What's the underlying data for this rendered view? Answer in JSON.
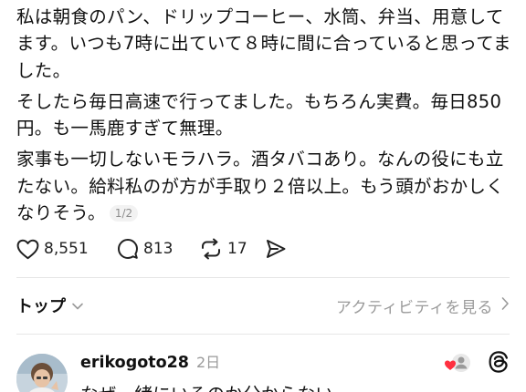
{
  "post": {
    "paragraphs": [
      "私は朝食のパン、ドリップコーヒー、水筒、弁当、用意してます。いつも7時に出ていて８時に間に合っていると思ってました。",
      "そしたら毎日高速で行ってました。もちろん実費。毎日850円。も一馬鹿すぎて無理。",
      "家事も一切しないモラハラ。酒タバコあり。なんの役にも立たない。給料私のが方が手取り２倍以上。もう頭がおかしくなりそう。"
    ],
    "page_indicator": "1/2"
  },
  "actions": {
    "likes": "8,551",
    "replies": "813",
    "reposts": "17"
  },
  "sort": {
    "label": "トップ",
    "activity_link": "アクティビティを見る"
  },
  "reply": {
    "username": "erikogoto28",
    "time": "2日",
    "text": "なぜ一緒にいるのか分からない"
  },
  "colors": {
    "text": "#111111",
    "muted": "#9a9a9a",
    "divider": "#e6e6e6",
    "like_heart": "#ff3040"
  },
  "icons": [
    "heart-icon",
    "comment-icon",
    "repost-icon",
    "share-icon",
    "chevron-down-icon",
    "chevron-right-icon",
    "liked-by-author-icon",
    "threads-logo-icon"
  ]
}
